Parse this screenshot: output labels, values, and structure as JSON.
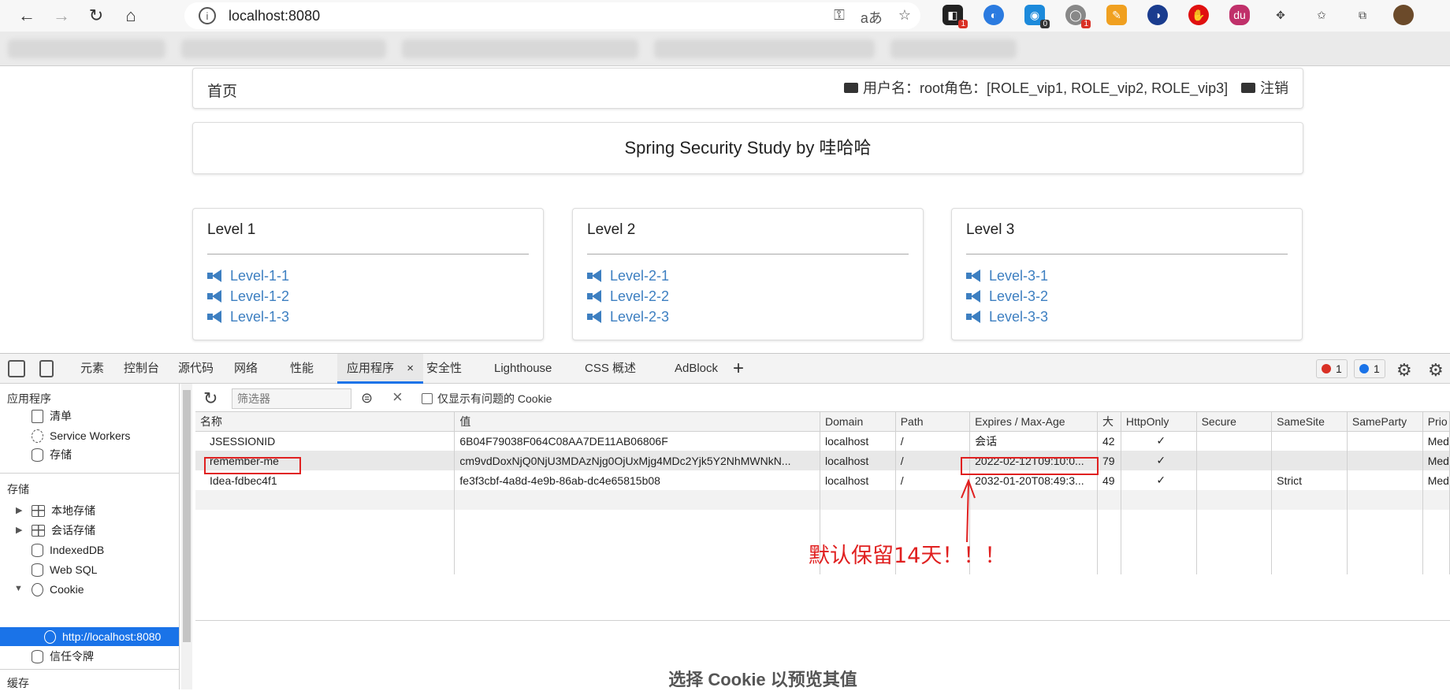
{
  "browser": {
    "url": "localhost:8080",
    "nav": {
      "back": "←",
      "forward": "→",
      "reload": "↻",
      "home": "⌂"
    },
    "extension_badges": [
      "1",
      "0",
      "1"
    ]
  },
  "page": {
    "home": "首页",
    "user_info": "用户名：root角色：[ROLE_vip1, ROLE_vip2, ROLE_vip3]",
    "logout": "注销",
    "title": "Spring Security Study by 哇哈哈",
    "levels": [
      {
        "title": "Level 1",
        "links": [
          "Level-1-1",
          "Level-1-2",
          "Level-1-3"
        ]
      },
      {
        "title": "Level 2",
        "links": [
          "Level-2-1",
          "Level-2-2",
          "Level-2-3"
        ]
      },
      {
        "title": "Level 3",
        "links": [
          "Level-3-1",
          "Level-3-2",
          "Level-3-3"
        ]
      }
    ],
    "link_color": "#3d7fc1"
  },
  "devtools": {
    "tabs": [
      "元素",
      "控制台",
      "源代码",
      "网络",
      "性能",
      "应用程序",
      "安全性",
      "Lighthouse",
      "CSS 概述",
      "AdBlock"
    ],
    "active_tab": "应用程序",
    "add_tab": "+",
    "error_count": "1",
    "message_count": "1",
    "sidebar": {
      "app_header": "应用程序",
      "app_items": [
        "清单",
        "Service Workers",
        "存储"
      ],
      "storage_header": "存储",
      "storage_items": [
        "本地存储",
        "会话存储",
        "IndexedDB",
        "Web SQL",
        "Cookie",
        "http://localhost:8080",
        "信任令牌"
      ],
      "cache_header": "缓存"
    },
    "cookies": {
      "filter_placeholder": "筛选器",
      "only_issues_label": "仅显示有问题的 Cookie",
      "columns": [
        "名称",
        "值",
        "Domain",
        "Path",
        "Expires / Max-Age",
        "大",
        "HttpOnly",
        "Secure",
        "SameSite",
        "SameParty",
        "Prio"
      ],
      "rows": [
        [
          "JSESSIONID",
          "6B04F79038F064C08AA7DE11AB06806F",
          "localhost",
          "/",
          "会话",
          "42",
          "✓",
          "",
          "",
          "",
          "Med"
        ],
        [
          "remember-me",
          "cm9vdDoxNjQ0NjU3MDAzNjg0OjUxMjg4MDc2Yjk5Y2NhMWNkN...",
          "localhost",
          "/",
          "2022-02-12T09:10:0...",
          "79",
          "✓",
          "",
          "",
          "",
          "Med"
        ],
        [
          "Idea-fdbec4f1",
          "fe3f3cbf-4a8d-4e9b-86ab-dc4e65815b08",
          "localhost",
          "/",
          "2032-01-20T08:49:3...",
          "49",
          "✓",
          "",
          "Strict",
          "",
          "Med"
        ]
      ],
      "preview_hint": "选择 Cookie 以预览其值"
    }
  },
  "annotation": {
    "text": "默认保留14天！！！",
    "color": "#e02020"
  }
}
